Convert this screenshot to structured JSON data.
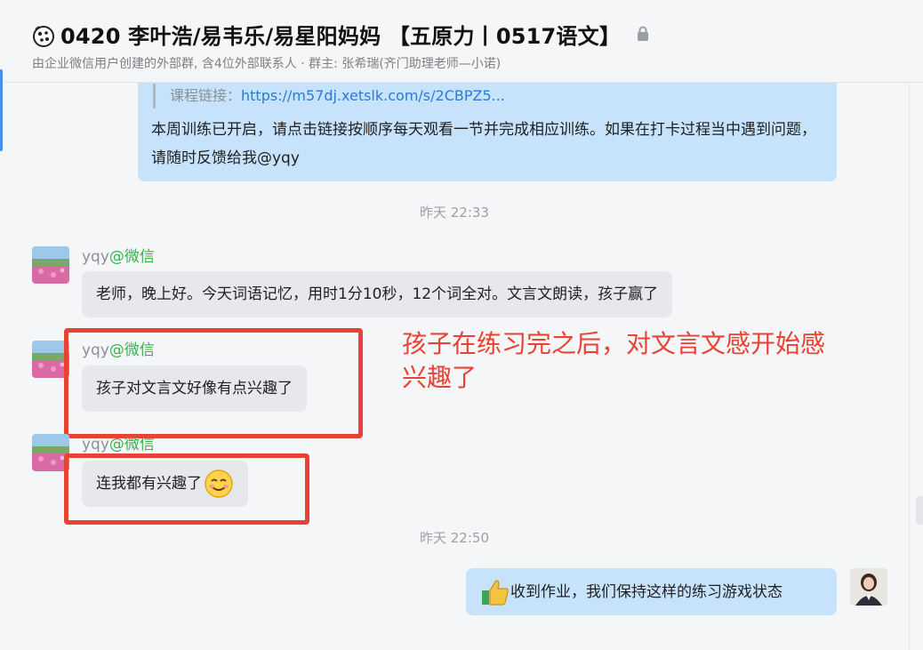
{
  "header": {
    "title": "0420 李叶浩/易韦乐/易星阳妈妈 【五原力丨0517语文】",
    "subtitle": "由企业微信用户创建的外部群, 含4位外部联系人 · 群主: 张希瑞(齐门助理老师—小诺)",
    "group_icon": "group-chat-icon",
    "lock_icon": "lock-icon"
  },
  "messages": {
    "quote_label": "课程链接：",
    "quote_link": "https://m57dj.xetslk.com/s/2CBPZ5...",
    "msg1_text": "本周训练已开启，请点击链接按顺序每天观看一节并完成相应训练。如果在打卡过程当中遇到问题，请随时反馈给我@yqy",
    "time1": "昨天 22:33",
    "sender_name": "yqy",
    "sender_tag": "@微信",
    "msg2_text": "老师，晚上好。今天词语记忆，用时1分10秒，12个词全对。文言文朗读，孩子赢了",
    "msg3_text": "孩子对文言文好像有点兴趣了",
    "msg4_text": "连我都有兴趣了",
    "time2": "昨天 22:50",
    "msg5_text": "收到作业，我们保持这样的练习游戏状态"
  },
  "annotation": {
    "text": "孩子在练习完之后，对文言文感开始感兴趣了",
    "color": "#e94235"
  },
  "colors": {
    "outgoing_bubble": "#c6e3fb",
    "incoming_bubble": "#e6e8eb",
    "sender_tag": "#37b24d",
    "link": "#2b7bd6"
  }
}
